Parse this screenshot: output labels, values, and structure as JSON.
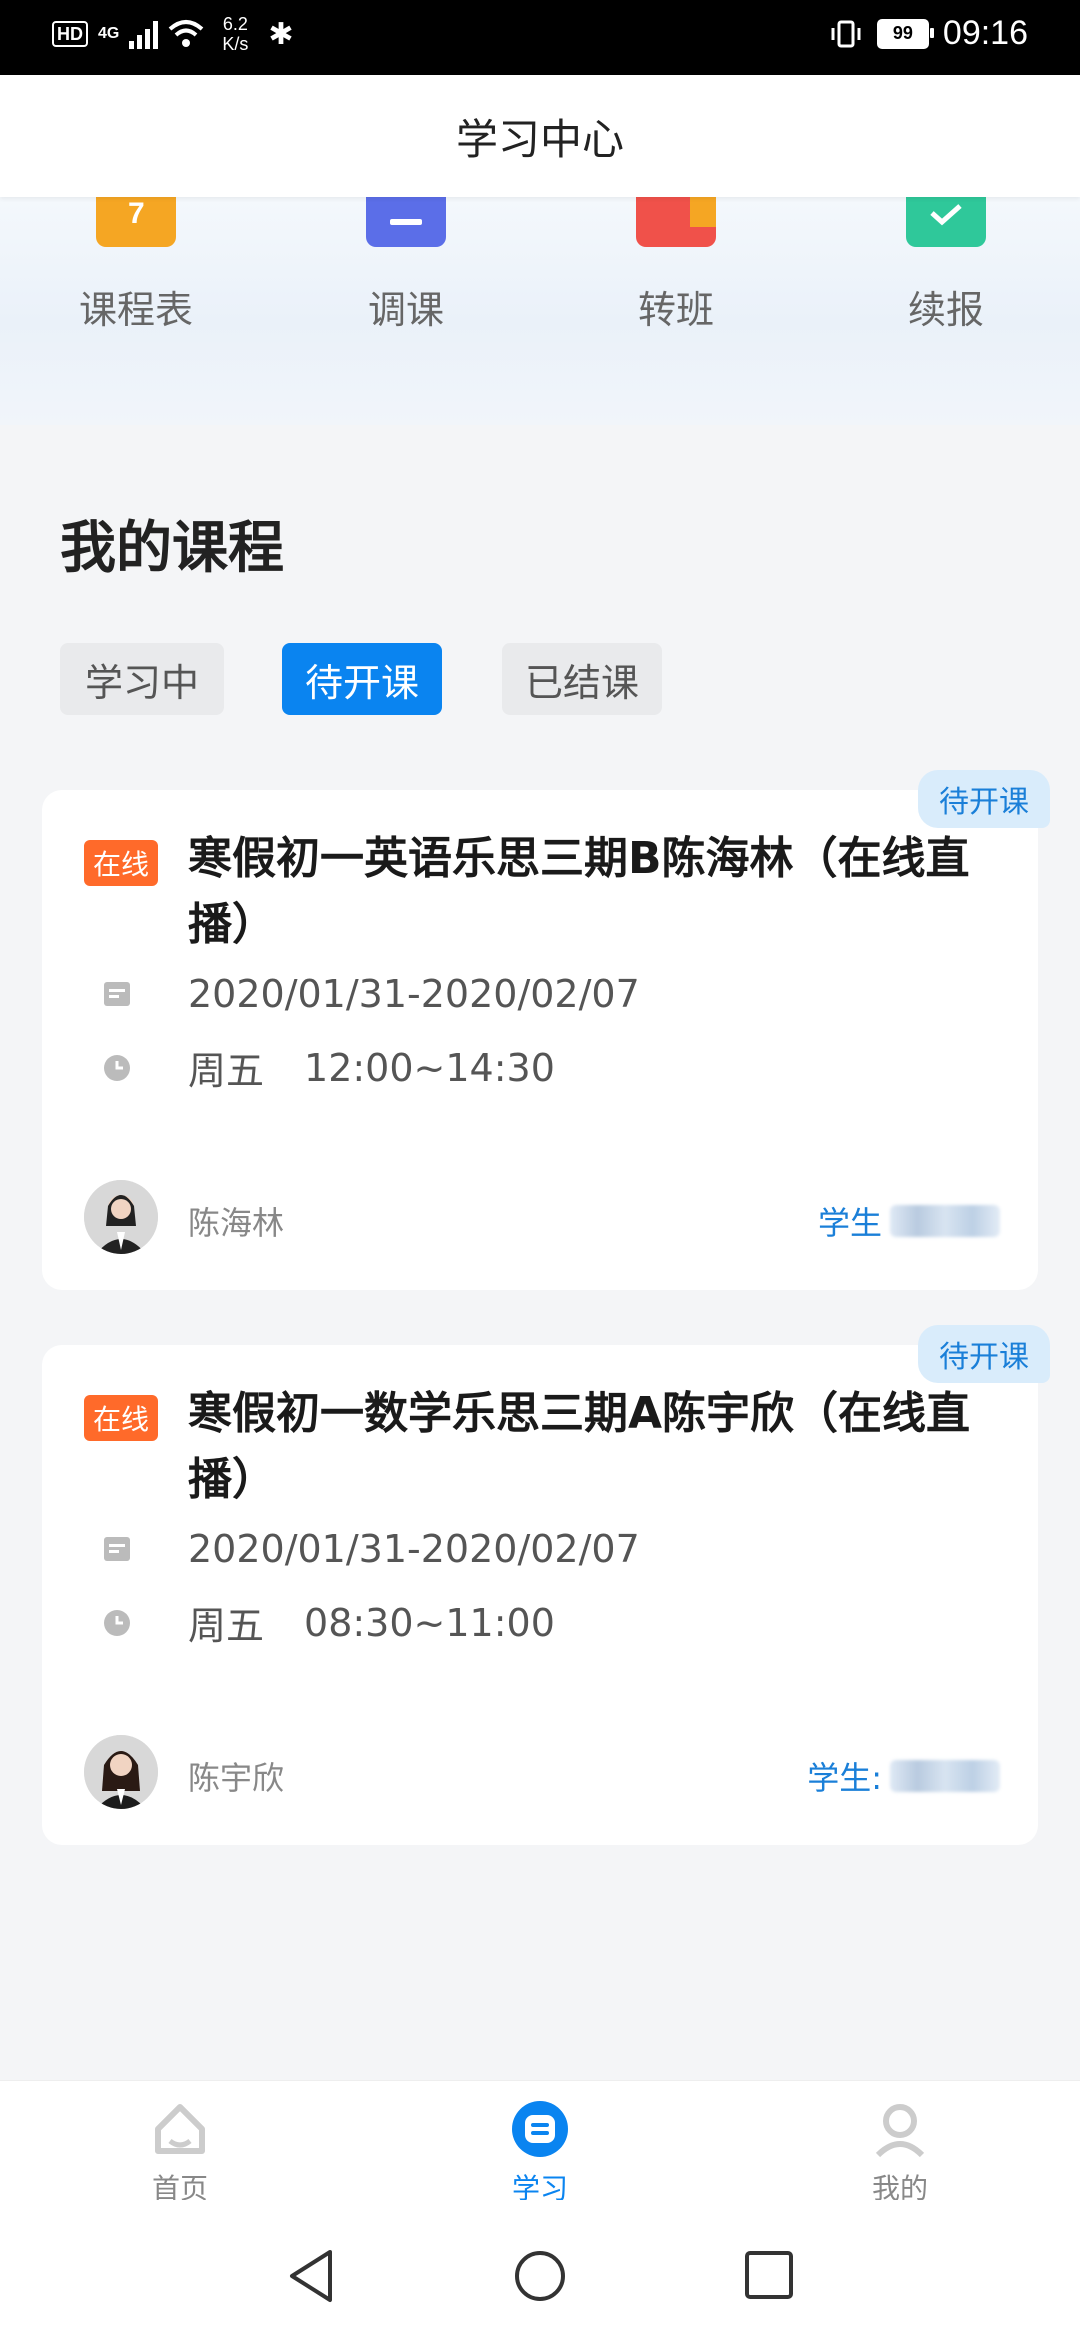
{
  "status_bar": {
    "hd": "HD",
    "network": "4G",
    "speed_value": "6.2",
    "speed_unit": "K/s",
    "battery": "99",
    "time": "09:16"
  },
  "app_bar": {
    "title": "学习中心"
  },
  "quick_actions": [
    {
      "label": "课程表",
      "icon": "calendar-icon",
      "color": "#f5a623"
    },
    {
      "label": "调课",
      "icon": "adjust-class-icon",
      "color": "#5b6ee8"
    },
    {
      "label": "转班",
      "icon": "transfer-class-icon",
      "color": "#f0514a"
    },
    {
      "label": "续报",
      "icon": "renew-check-icon",
      "color": "#2fc89a"
    }
  ],
  "section": {
    "title": "我的课程"
  },
  "tabs": [
    {
      "label": "学习中",
      "active": false
    },
    {
      "label": "待开课",
      "active": true
    },
    {
      "label": "已结课",
      "active": false
    }
  ],
  "courses": [
    {
      "status": "待开课",
      "tag": "在线",
      "title": "寒假初一英语乐思三期B陈海林（在线直播）",
      "date_range": "2020/01/31-2020/02/07",
      "day": "周五",
      "time": "12:00~14:30",
      "teacher": "陈海林",
      "student_label": "学生"
    },
    {
      "status": "待开课",
      "tag": "在线",
      "title": "寒假初一数学乐思三期A陈宇欣（在线直播）",
      "date_range": "2020/01/31-2020/02/07",
      "day": "周五",
      "time": "08:30~11:00",
      "teacher": "陈宇欣",
      "student_label": "学生:"
    }
  ],
  "bottom_nav": [
    {
      "label": "首页",
      "icon": "home-icon",
      "active": false
    },
    {
      "label": "学习",
      "icon": "study-icon",
      "active": true
    },
    {
      "label": "我的",
      "icon": "profile-icon",
      "active": false
    }
  ],
  "colors": {
    "accent": "#0a84f0",
    "tag": "#ff6a2a",
    "badge_bg": "#d9ecfb"
  }
}
